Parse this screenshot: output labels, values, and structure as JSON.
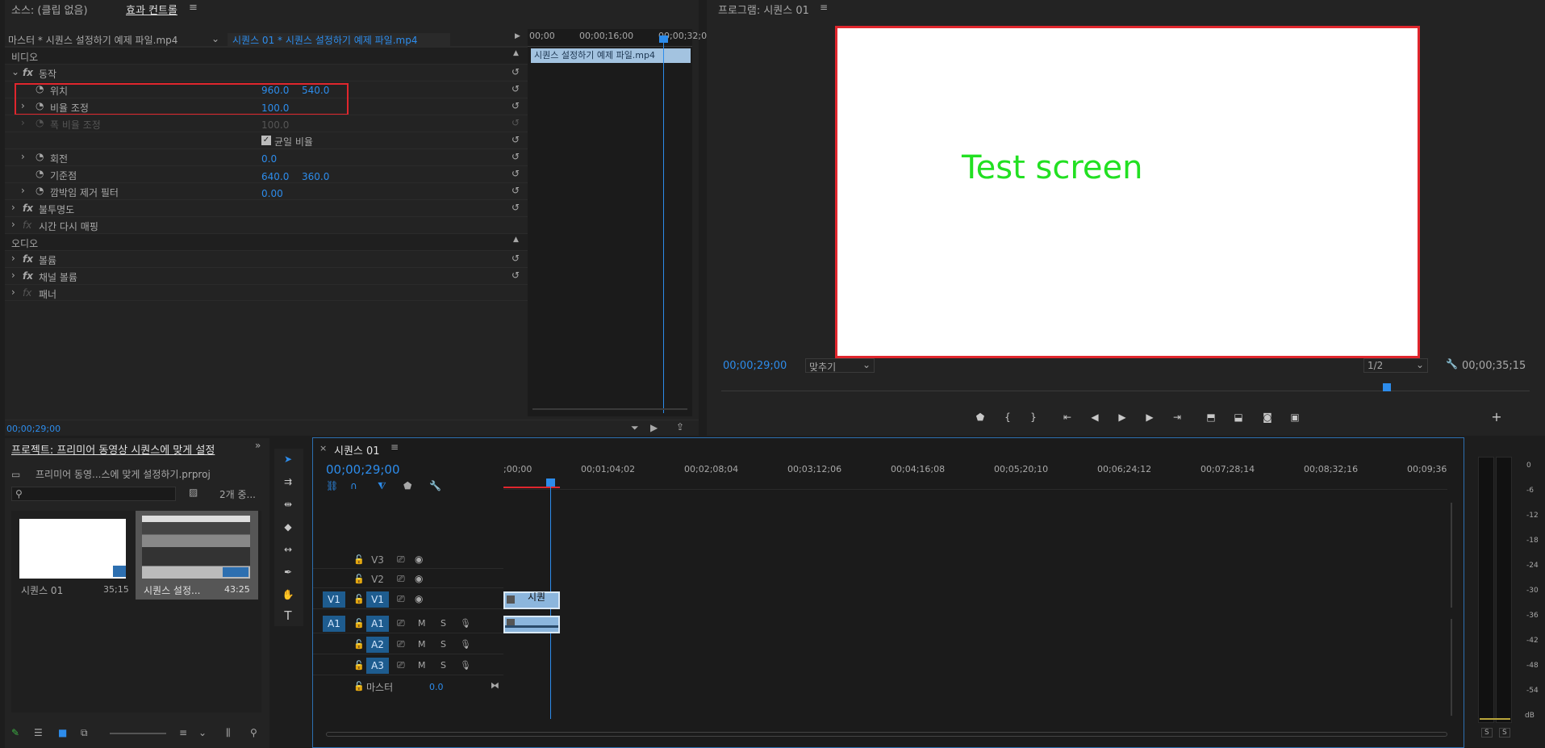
{
  "source_tab": "소스: (클립 없음)",
  "effect_tab": "효과 컨트롤",
  "program_title": "프로그램: 시퀀스 01",
  "master_clip": "마스터 * 시퀀스 설정하기 예제 파일.mp4",
  "seq_clip": "시퀀스 01 * 시퀀스 설정하기 예제 파일.mp4",
  "ec_ruler": [
    "00;00",
    "00;00;16;00",
    "00;00;32;0"
  ],
  "ec_clip_label": "시퀀스 설정하기 예제 파일.mp4",
  "video_section": "비디오",
  "audio_section": "오디오",
  "effects": [
    {
      "label": "동작",
      "fx": true
    },
    {
      "label": "위치",
      "v1": "960.0",
      "v2": "540.0"
    },
    {
      "label": "비율 조정",
      "v1": "100.0"
    },
    {
      "label": "폭 비율 조정",
      "v1": "100.0",
      "disabled": true
    },
    {
      "label": "균일 비율",
      "checkbox": true
    },
    {
      "label": "회전",
      "v1": "0.0"
    },
    {
      "label": "기준점",
      "v1": "640.0",
      "v2": "360.0"
    },
    {
      "label": "깜박임 제거 필터",
      "v1": "0.00"
    },
    {
      "label": "불투명도",
      "fx": true
    },
    {
      "label": "시간 다시 매핑",
      "fx": true,
      "dim": true
    }
  ],
  "audio_effects": [
    "볼륨",
    "채널 볼륨",
    "패너"
  ],
  "ec_timecode": "00;00;29;00",
  "monitor_text": "Test screen",
  "prog_timecode": "00;00;29;00",
  "fit_select": "맞추기",
  "resolution_select": "1/2",
  "prog_duration": "00;00;35;15",
  "project_title": "프로젝트: 프리미어 동영상 시퀀스에 맞게 설정",
  "project_file": "프리미어 동영...스에 맞게 설정하기.prproj",
  "items_count": "2개 중...",
  "bins": [
    {
      "name": "시퀀스 01",
      "dur": "35;15"
    },
    {
      "name": "시퀀스 설정...",
      "dur": "43:25"
    }
  ],
  "timeline_tab": "시퀀스 01",
  "tl_timecode": "00;00;29;00",
  "tl_ruler": [
    ";00;00",
    "00;01;04;02",
    "00;02;08;04",
    "00;03;12;06",
    "00;04;16;08",
    "00;05;20;10",
    "00;06;24;12",
    "00;07;28;14",
    "00;08;32;16",
    "00;09;36"
  ],
  "tracks_video": [
    "V3",
    "V2",
    "V1"
  ],
  "tracks_audio": [
    "A1",
    "A2",
    "A3"
  ],
  "master_label": "마스터",
  "master_val": "0.0",
  "clip_v1_label": "시퀀",
  "meter_scale": [
    "0",
    "-6",
    "-12",
    "-18",
    "-24",
    "-30",
    "-36",
    "-42",
    "-48",
    "-54",
    "dB"
  ],
  "meter_solo": [
    "S",
    "S"
  ],
  "colors": {
    "accent": "#2d8ceb",
    "highlight": "#e0262d",
    "bg": "#232323",
    "monitor_text": "#22e022"
  }
}
